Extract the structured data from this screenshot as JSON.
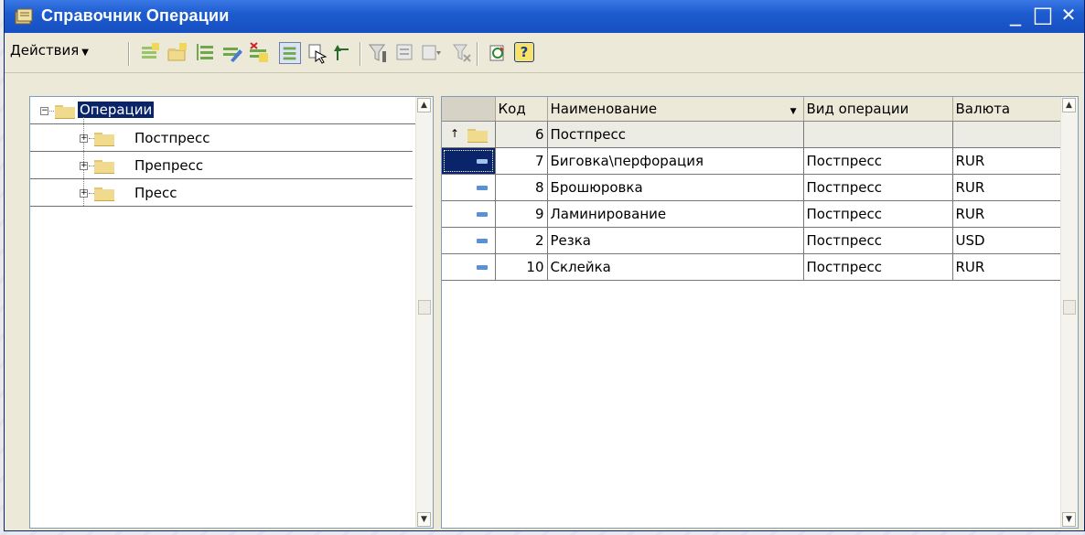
{
  "window": {
    "title": "Справочник Операции",
    "controls": {
      "minimize": "_",
      "maximize": "□",
      "close": "✕"
    }
  },
  "toolbar": {
    "actions_label": "Действия",
    "icons": [
      "add-row-icon",
      "add-group-icon",
      "copy-row-icon",
      "edit-row-icon",
      "delete-mark-icon",
      "hierarchy-view-icon",
      "move-to-group-icon",
      "level-up-icon",
      "filter-set-icon",
      "filter-by-value-icon",
      "filter-history-icon",
      "filter-clear-icon",
      "refresh-icon",
      "help-icon"
    ],
    "help_label": "?"
  },
  "tree": {
    "root": {
      "label": "Операции",
      "expander": "⊟"
    },
    "children": [
      {
        "label": "Постпресс",
        "expander": "⊞"
      },
      {
        "label": "Препресс",
        "expander": "⊞"
      },
      {
        "label": "Пресс",
        "expander": "⊞"
      }
    ]
  },
  "table": {
    "headers": {
      "code": "Код",
      "name": "Наименование",
      "type": "Вид операции",
      "currency": "Валюта",
      "sort_marker": "▼"
    },
    "group_row": {
      "up_marker": "↑",
      "code": "6",
      "name": "Постпресс"
    },
    "rows": [
      {
        "code": "7",
        "name": "Биговка\\перфорация",
        "type": "Постпресс",
        "currency": "RUR"
      },
      {
        "code": "8",
        "name": "Брошюровка",
        "type": "Постпресс",
        "currency": "RUR"
      },
      {
        "code": "9",
        "name": "Ламинирование",
        "type": "Постпресс",
        "currency": "RUR"
      },
      {
        "code": "2",
        "name": "Резка",
        "type": "Постпресс",
        "currency": "USD"
      },
      {
        "code": "10",
        "name": "Склейка",
        "type": "Постпресс",
        "currency": "RUR"
      }
    ]
  },
  "scrollbar": {
    "up": "▲",
    "down": "▼"
  },
  "colors": {
    "titlebar": "#1d5ccf",
    "selection": "#0a246a",
    "window_bg": "#ece9d8"
  }
}
